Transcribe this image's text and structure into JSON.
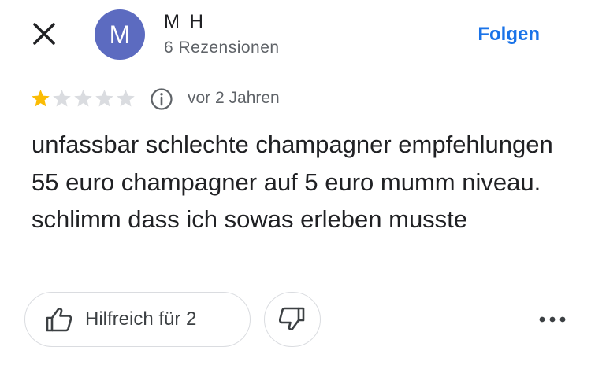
{
  "header": {
    "avatar_letter": "M",
    "user_name": "M H",
    "review_count": "6 Rezensionen",
    "follow_label": "Folgen"
  },
  "review": {
    "rating": 1,
    "max_rating": 5,
    "timestamp": "vor 2 Jahren",
    "text": "unfassbar schlechte champagner empfehlungen 55 euro champagner auf 5 euro mumm niveau. schlimm dass ich sowas erleben musste"
  },
  "actions": {
    "helpful_label": "Hilfreich für 2"
  },
  "icons": {
    "close": "close-icon",
    "info": "info-icon",
    "thumbs_up": "thumbs-up-icon",
    "thumbs_down": "thumbs-down-icon",
    "more": "more-options-icon"
  },
  "colors": {
    "accent": "#1a73e8",
    "avatar_bg": "#5c6bc0",
    "star_filled": "#fbbc04",
    "star_empty": "#dadce0"
  }
}
